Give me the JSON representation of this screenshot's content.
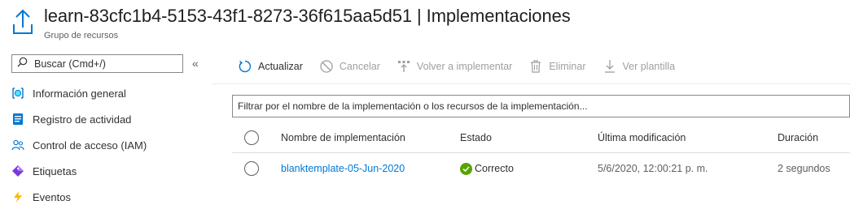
{
  "header": {
    "title": "learn-83cfc1b4-5153-43f1-8273-36f615aa5d51 | Implementaciones",
    "subtitle": "Grupo de recursos",
    "icon": "upload-deploy-icon"
  },
  "sidebar": {
    "search": {
      "placeholder": "Buscar (Cmd+/)",
      "value": ""
    },
    "collapse_label": "«",
    "items": [
      {
        "label": "Información general",
        "icon": "overview-icon"
      },
      {
        "label": "Registro de actividad",
        "icon": "activity-log-icon"
      },
      {
        "label": "Control de acceso (IAM)",
        "icon": "iam-icon"
      },
      {
        "label": "Etiquetas",
        "icon": "tag-icon"
      },
      {
        "label": "Eventos",
        "icon": "lightning-icon"
      }
    ]
  },
  "toolbar": {
    "refresh": "Actualizar",
    "cancel": "Cancelar",
    "redeploy": "Volver a implementar",
    "delete": "Eliminar",
    "view_template": "Ver plantilla"
  },
  "filter": {
    "placeholder": "Filtrar por el nombre de la implementación o los recursos de la implementación...",
    "value": ""
  },
  "table": {
    "columns": [
      "Nombre de implementación",
      "Estado",
      "Última modificación",
      "Duración"
    ],
    "rows": [
      {
        "name": "blanktemplate-05-Jun-2020",
        "status": "Correcto",
        "modified": "5/6/2020, 12:00:21 p. m.",
        "duration": "2 segundos"
      }
    ]
  },
  "colors": {
    "accent": "#0078d4",
    "success": "#57a300",
    "disabled": "#a19f9d"
  }
}
